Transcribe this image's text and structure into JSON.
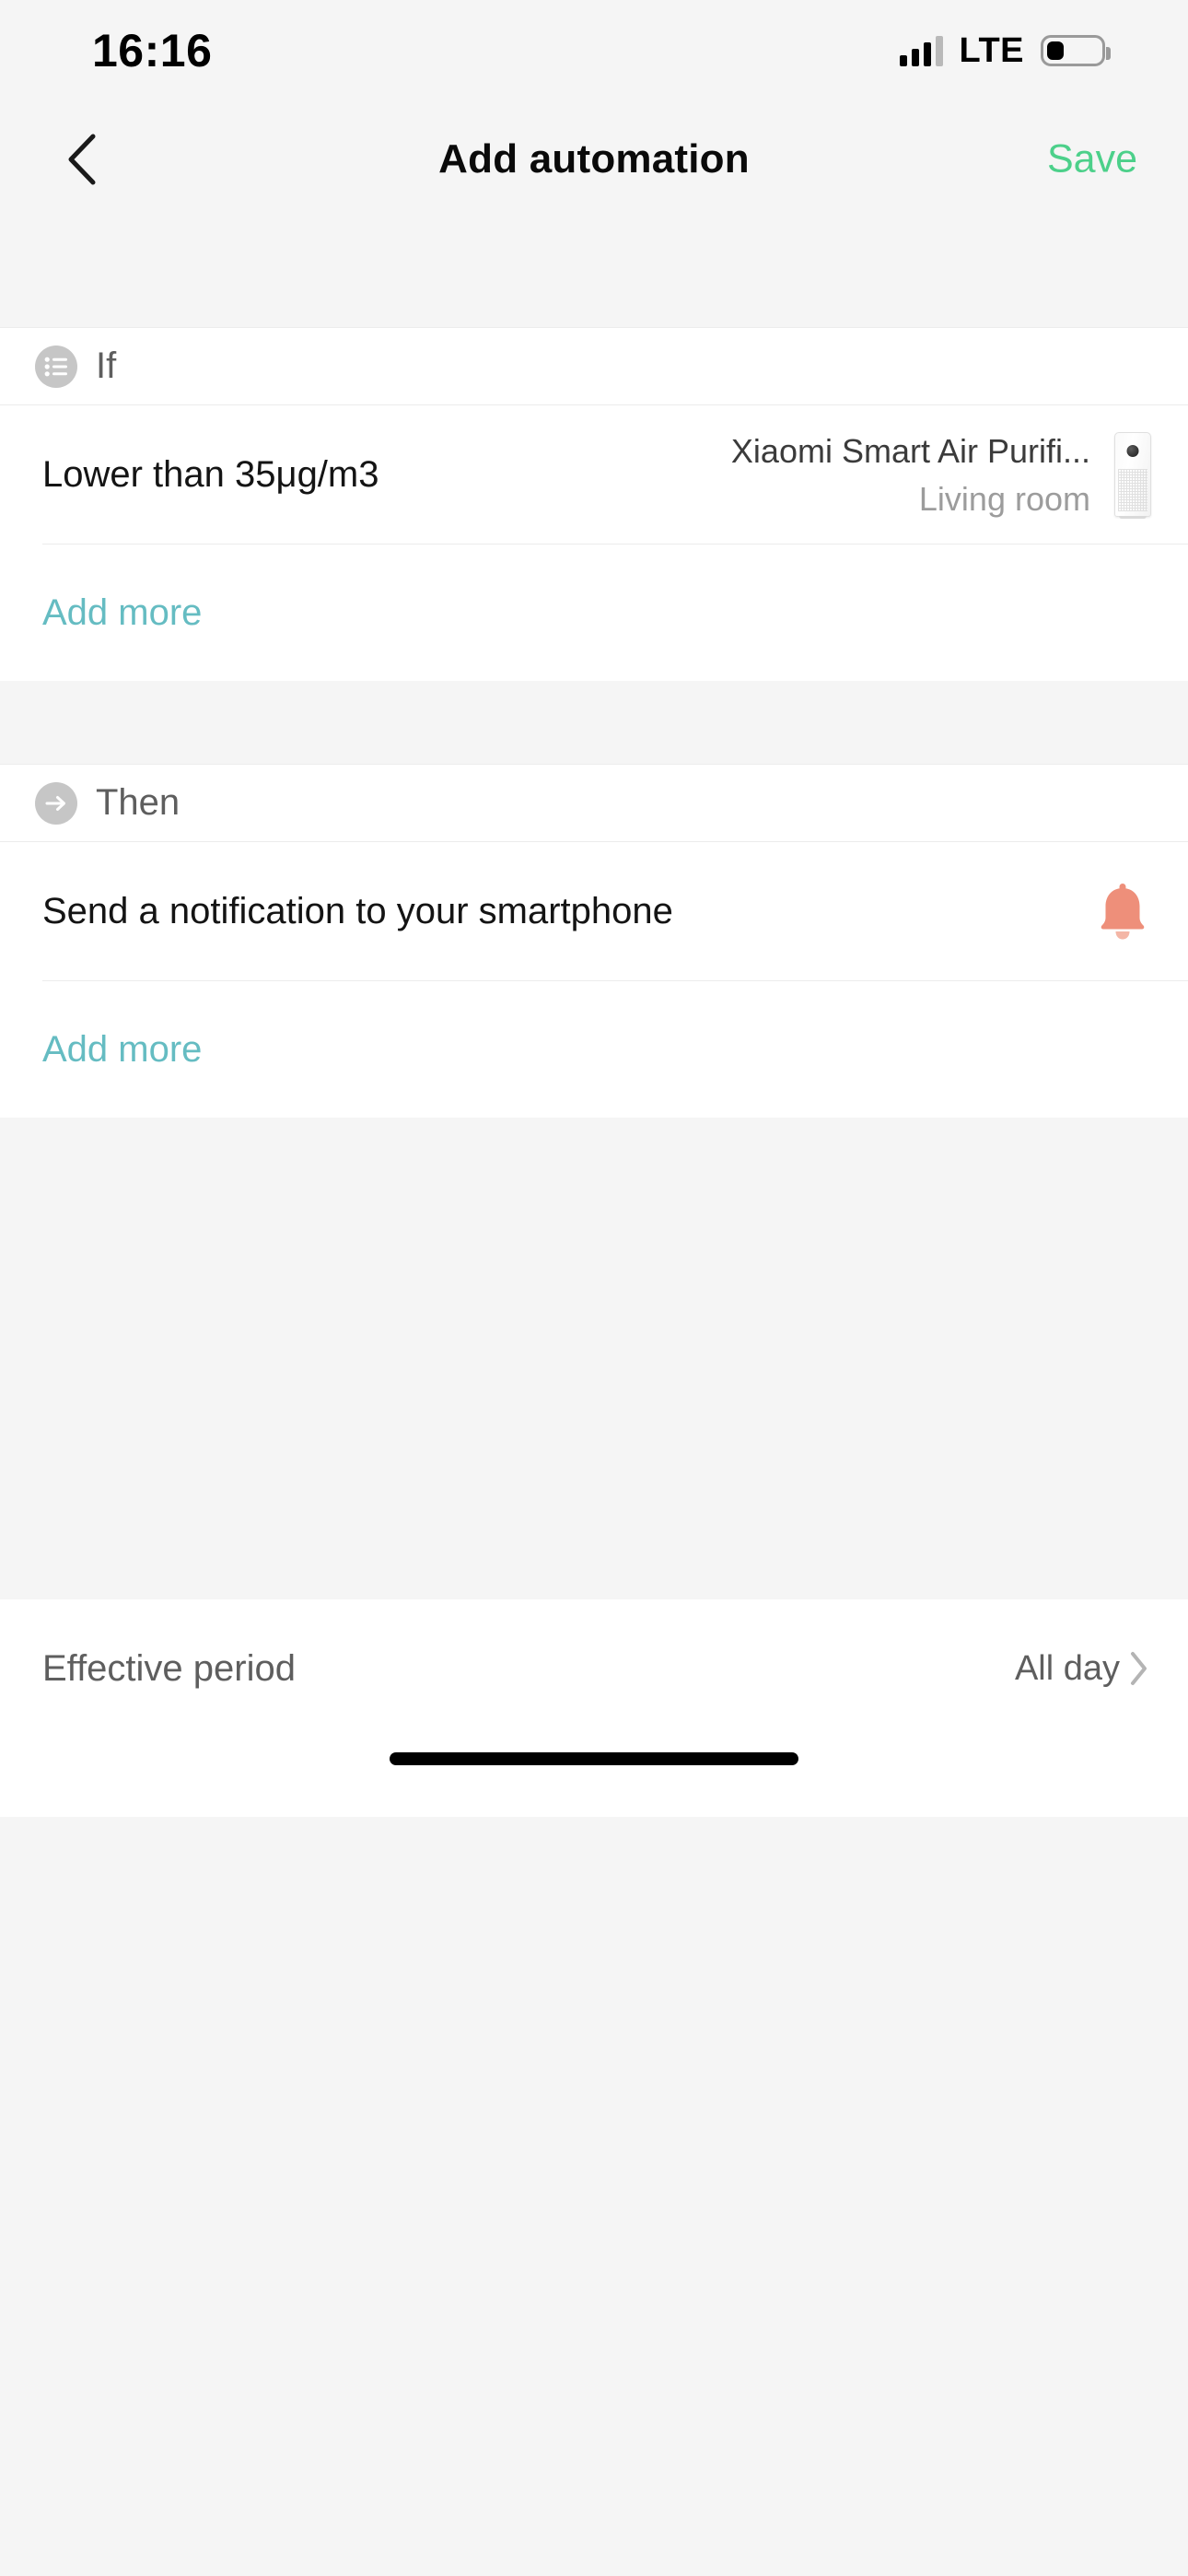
{
  "status_bar": {
    "time": "16:16",
    "network_label": "LTE",
    "signal_icon": "signal-bars-icon",
    "battery_icon": "battery-icon"
  },
  "nav": {
    "back_icon": "chevron-left-icon",
    "title": "Add automation",
    "save_label": "Save",
    "save_color": "#4CD08A"
  },
  "if_section": {
    "badge_icon": "list-icon",
    "label": "If",
    "conditions": [
      {
        "text": "Lower than 35μg/m3",
        "device_name": "Xiaomi Smart Air Purifi...",
        "room": "Living room",
        "thumb_icon": "air-purifier-icon"
      }
    ],
    "add_more_label": "Add more"
  },
  "then_section": {
    "badge_icon": "arrow-right-icon",
    "label": "Then",
    "actions": [
      {
        "text": "Send a notification to your smartphone",
        "icon": "bell-icon",
        "icon_color": "#EE8F7A"
      }
    ],
    "add_more_label": "Add more"
  },
  "footer": {
    "effective_period_label": "Effective period",
    "effective_period_value": "All day",
    "chevron_icon": "chevron-right-icon"
  },
  "theme": {
    "accent_teal": "#65BCC2",
    "accent_green": "#4CD08A",
    "page_background": "#F5F5F5",
    "card_background": "#FFFFFF"
  }
}
